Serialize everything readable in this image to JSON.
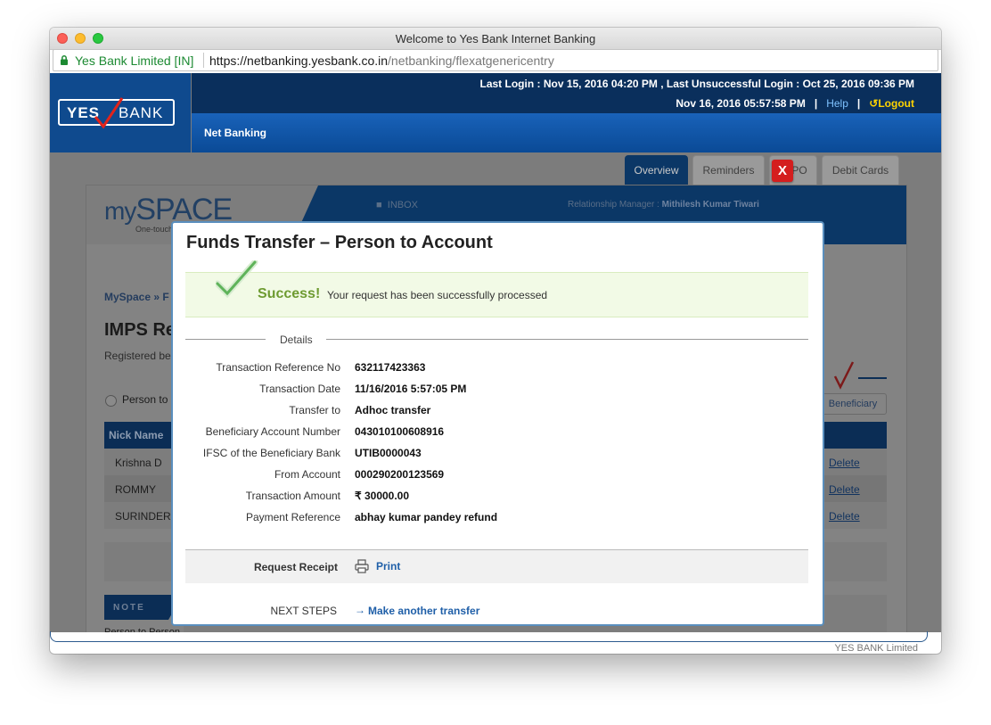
{
  "window": {
    "title": "Welcome to Yes Bank Internet Banking",
    "site_identity": "Yes Bank Limited [IN]",
    "url_scheme": "https://",
    "url_host": "netbanking.yesbank.co.in",
    "url_path": "/netbanking/flexatgenericentry"
  },
  "header": {
    "logo_yes": "YES",
    "logo_bank": "BANK",
    "last_login": "Last Login : Nov 15, 2016 04:20 PM , Last Unsuccessful Login : Oct 25, 2016 09:36 PM",
    "current_time": "Nov 16, 2016 05:57:58 PM",
    "separator": "|",
    "help": "Help",
    "logout": "Logout",
    "nav_label": "Net Banking"
  },
  "tabs": [
    {
      "label": "Overview",
      "active": true
    },
    {
      "label": "Reminders",
      "active": false
    },
    {
      "label": "e-IPO",
      "active": false
    },
    {
      "label": "Debit Cards",
      "active": false
    }
  ],
  "background": {
    "myspace_my": "my",
    "myspace_space": "SPACE",
    "myspace_tag": "One-touch",
    "inbox": "INBOX",
    "rm_label": "Relationship Manager :",
    "rm_name": "Mithilesh Kumar Tiwari",
    "breadcrumb": "MySpace  »  F",
    "page_heading": "IMPS Re",
    "registered_text": "Registered be",
    "radio_label": "Person to",
    "add_beneficiary": "Beneficiary",
    "table_header": "Nick Name",
    "rows": [
      {
        "name": "Krishna D",
        "action": "Delete"
      },
      {
        "name": "ROMMY",
        "action": "Delete"
      },
      {
        "name": "SURINDER",
        "action": "Delete"
      }
    ],
    "note_label": "NOTE",
    "note_text": "Person to Person",
    "footer": "YES BANK Limited"
  },
  "modal": {
    "title": "Funds Transfer – Person to Account",
    "close_label": "X",
    "success_word": "Success!",
    "success_message": "Your request has been successfully processed",
    "details_label": "Details",
    "details": [
      {
        "label": "Transaction Reference No",
        "value": "632117423363"
      },
      {
        "label": "Transaction Date",
        "value": "11/16/2016 5:57:05 PM"
      },
      {
        "label": "Transfer to",
        "value": "Adhoc transfer"
      },
      {
        "label": "Beneficiary Account Number",
        "value": "043010100608916"
      },
      {
        "label": "IFSC of the Beneficiary Bank",
        "value": "UTIB0000043"
      },
      {
        "label": "From Account",
        "value": "000290200123569"
      },
      {
        "label": "Transaction Amount",
        "value": "₹  30000.00"
      },
      {
        "label": "Payment Reference",
        "value": "abhay kumar pandey refund"
      }
    ],
    "receipt_label": "Request Receipt",
    "print_label": "Print",
    "next_steps_label": "NEXT STEPS",
    "next_steps_link": "Make another transfer"
  },
  "colors": {
    "brand_blue": "#0f4a8e",
    "success_green": "#6e9b31",
    "close_red": "#d41e1e",
    "link_blue": "#1f5fa8"
  }
}
